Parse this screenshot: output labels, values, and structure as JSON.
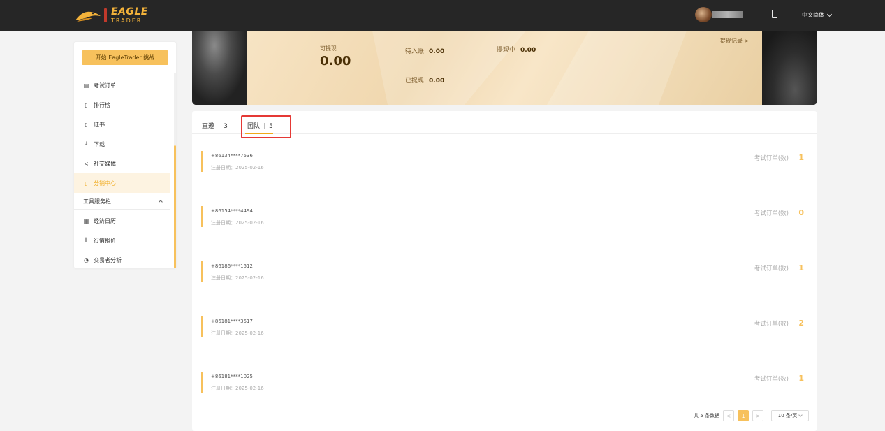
{
  "header": {
    "brand": "EAGLE",
    "brand_sub": "TRADER",
    "language": "中文简体"
  },
  "sidebar": {
    "start_button": "开始 EagleTrader 挑战",
    "items": [
      {
        "label": "考试订单",
        "icon": "clipboard-icon"
      },
      {
        "label": "排行榜",
        "icon": "trophy-icon"
      },
      {
        "label": "证书",
        "icon": "certificate-icon"
      },
      {
        "label": "下载",
        "icon": "download-icon"
      },
      {
        "label": "社交媒体",
        "icon": "share-icon"
      },
      {
        "label": "分销中心",
        "icon": "distribution-icon",
        "active": true
      }
    ],
    "group": "工具服务栏",
    "tools": [
      {
        "label": "经济日历",
        "icon": "calendar-icon"
      },
      {
        "label": "行情报价",
        "icon": "quote-icon"
      },
      {
        "label": "交易者分析",
        "icon": "analysis-icon"
      }
    ]
  },
  "banner": {
    "withdrawable_label": "可提现",
    "withdrawable_value": "0.00",
    "pending_label": "待入账",
    "pending_value": "0.00",
    "withdrawing_label": "提现中",
    "withdrawing_value": "0.00",
    "withdrawn_label": "已提现",
    "withdrawn_value": "0.00",
    "record_link": "提现记录 >"
  },
  "tabs": [
    {
      "label": "直邀",
      "count": "3"
    },
    {
      "label": "团队",
      "count": "5",
      "active": true
    }
  ],
  "members": [
    {
      "phone": "+86134****7536",
      "date": "注册日期：2025-02-16",
      "count_label": "考试订单(数)",
      "count": "1"
    },
    {
      "phone": "+86154****4494",
      "date": "注册日期：2025-02-16",
      "count_label": "考试订单(数)",
      "count": "0"
    },
    {
      "phone": "+86186****1512",
      "date": "注册日期：2025-02-16",
      "count_label": "考试订单(数)",
      "count": "1"
    },
    {
      "phone": "+86181****3517",
      "date": "注册日期：2025-02-16",
      "count_label": "考试订单(数)",
      "count": "2"
    },
    {
      "phone": "+86181****1025",
      "date": "注册日期：2025-02-16",
      "count_label": "考试订单(数)",
      "count": "1"
    }
  ],
  "pagination": {
    "total": "共 5 条数据",
    "prev": "<",
    "page": "1",
    "next": ">",
    "page_size": "10 条/页"
  },
  "colors": {
    "accent": "#f7c15c",
    "header_bg": "#262626",
    "highlight_box": "#e53935"
  }
}
